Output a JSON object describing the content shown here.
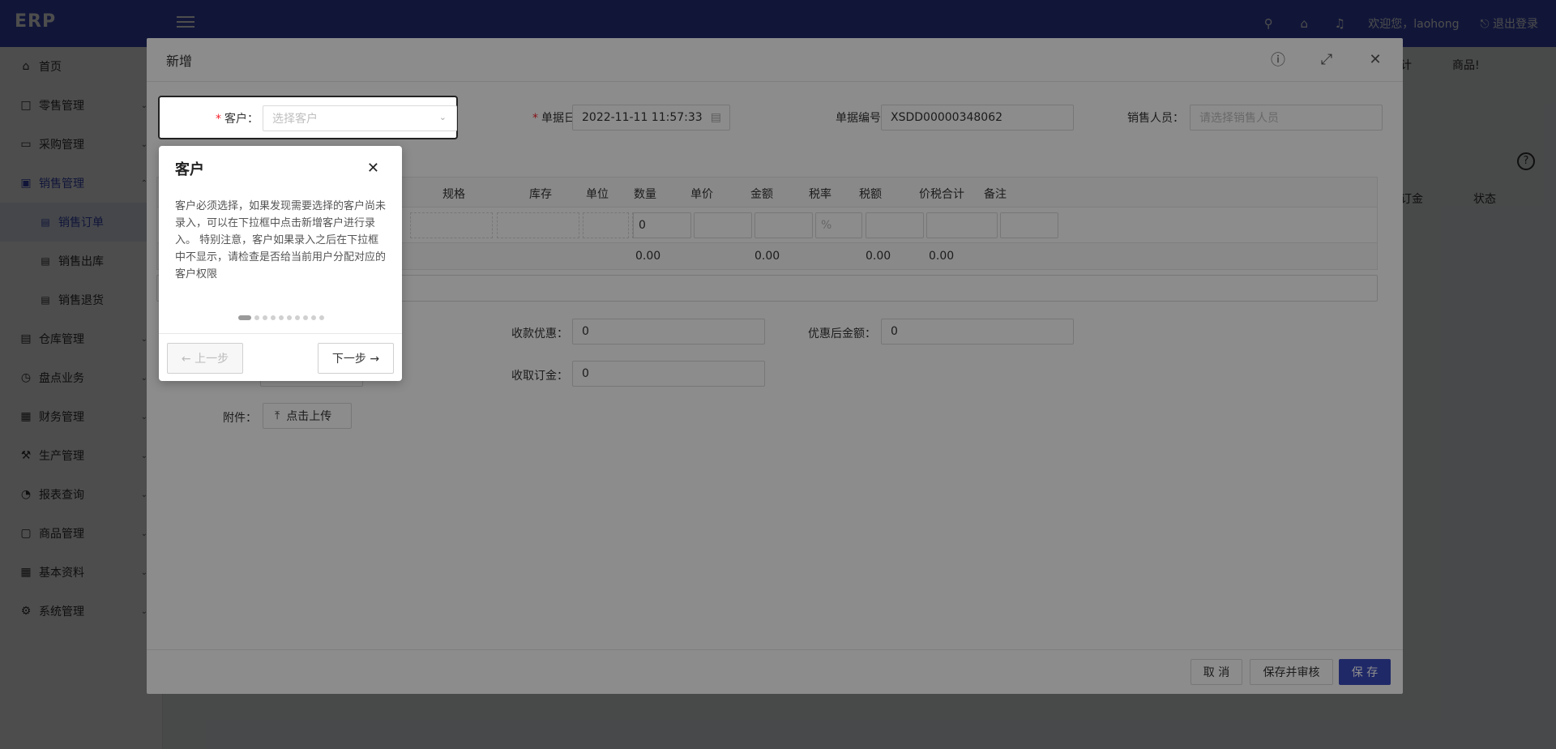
{
  "app": {
    "logo": "ERP",
    "welcome": "欢迎您，laohong",
    "logout": "退出登录"
  },
  "sidebar": {
    "items": [
      {
        "label": "首页",
        "icon": "home-icon"
      },
      {
        "label": "零售管理",
        "icon": "gift-icon"
      },
      {
        "label": "采购管理",
        "icon": "card-icon"
      },
      {
        "label": "销售管理",
        "icon": "cart-icon"
      },
      {
        "label": "仓库管理",
        "icon": "file-icon"
      },
      {
        "label": "盘点业务",
        "icon": "clock-icon"
      },
      {
        "label": "财务管理",
        "icon": "money-icon"
      },
      {
        "label": "生产管理",
        "icon": "tool-icon"
      },
      {
        "label": "报表查询",
        "icon": "chart-icon"
      },
      {
        "label": "商品管理",
        "icon": "bag-icon"
      },
      {
        "label": "基本资料",
        "icon": "grid-icon"
      },
      {
        "label": "系统管理",
        "icon": "gear-icon"
      }
    ],
    "sales_sub": [
      "销售订单",
      "销售出库",
      "销售退货"
    ]
  },
  "background": {
    "tabs": [
      "户统计",
      "商品!"
    ],
    "table_head": [
      "收取订金",
      "状态"
    ]
  },
  "modal": {
    "title": "新增",
    "fields": {
      "customer_label": "客户",
      "customer_placeholder": "选择客户",
      "date_label": "单据日期",
      "date_value": "2022-11-11 11:57:33",
      "number_label": "单据编号",
      "number_value": "XSDD00000348062",
      "salesperson_label": "销售人员",
      "salesperson_placeholder": "请选择销售人员"
    },
    "grid": {
      "columns": [
        "规格",
        "库存",
        "单位",
        "数量",
        "单价",
        "金额",
        "税率",
        "税额",
        "价税合计",
        "备注"
      ],
      "row": {
        "qty": "0",
        "tax_rate_placeholder": "%"
      },
      "sums": {
        "qty": "0.00",
        "amount": "0.00",
        "tax": "0.00",
        "total": "0.00"
      }
    },
    "payment": {
      "discount_label": "收款优惠",
      "discount_value": "0",
      "after_label": "优惠后金额",
      "after_value": "0",
      "deposit_label": "收取订金",
      "deposit_value": "0",
      "attach_label": "附件",
      "upload_label": "点击上传"
    },
    "footer": {
      "cancel": "取 消",
      "save_audit": "保存并审核",
      "save": "保 存"
    }
  },
  "tour": {
    "title": "客户",
    "body": "客户必须选择，如果发现需要选择的客户尚未录入，可以在下拉框中点击新增客户进行录入。 特别注意，客户如果录入之后在下拉框中不显示，请检查是否给当前用户分配对应的客户权限",
    "steps_total": 10,
    "current_step": 1,
    "prev": "← 上一步",
    "next": "下一步 →"
  }
}
